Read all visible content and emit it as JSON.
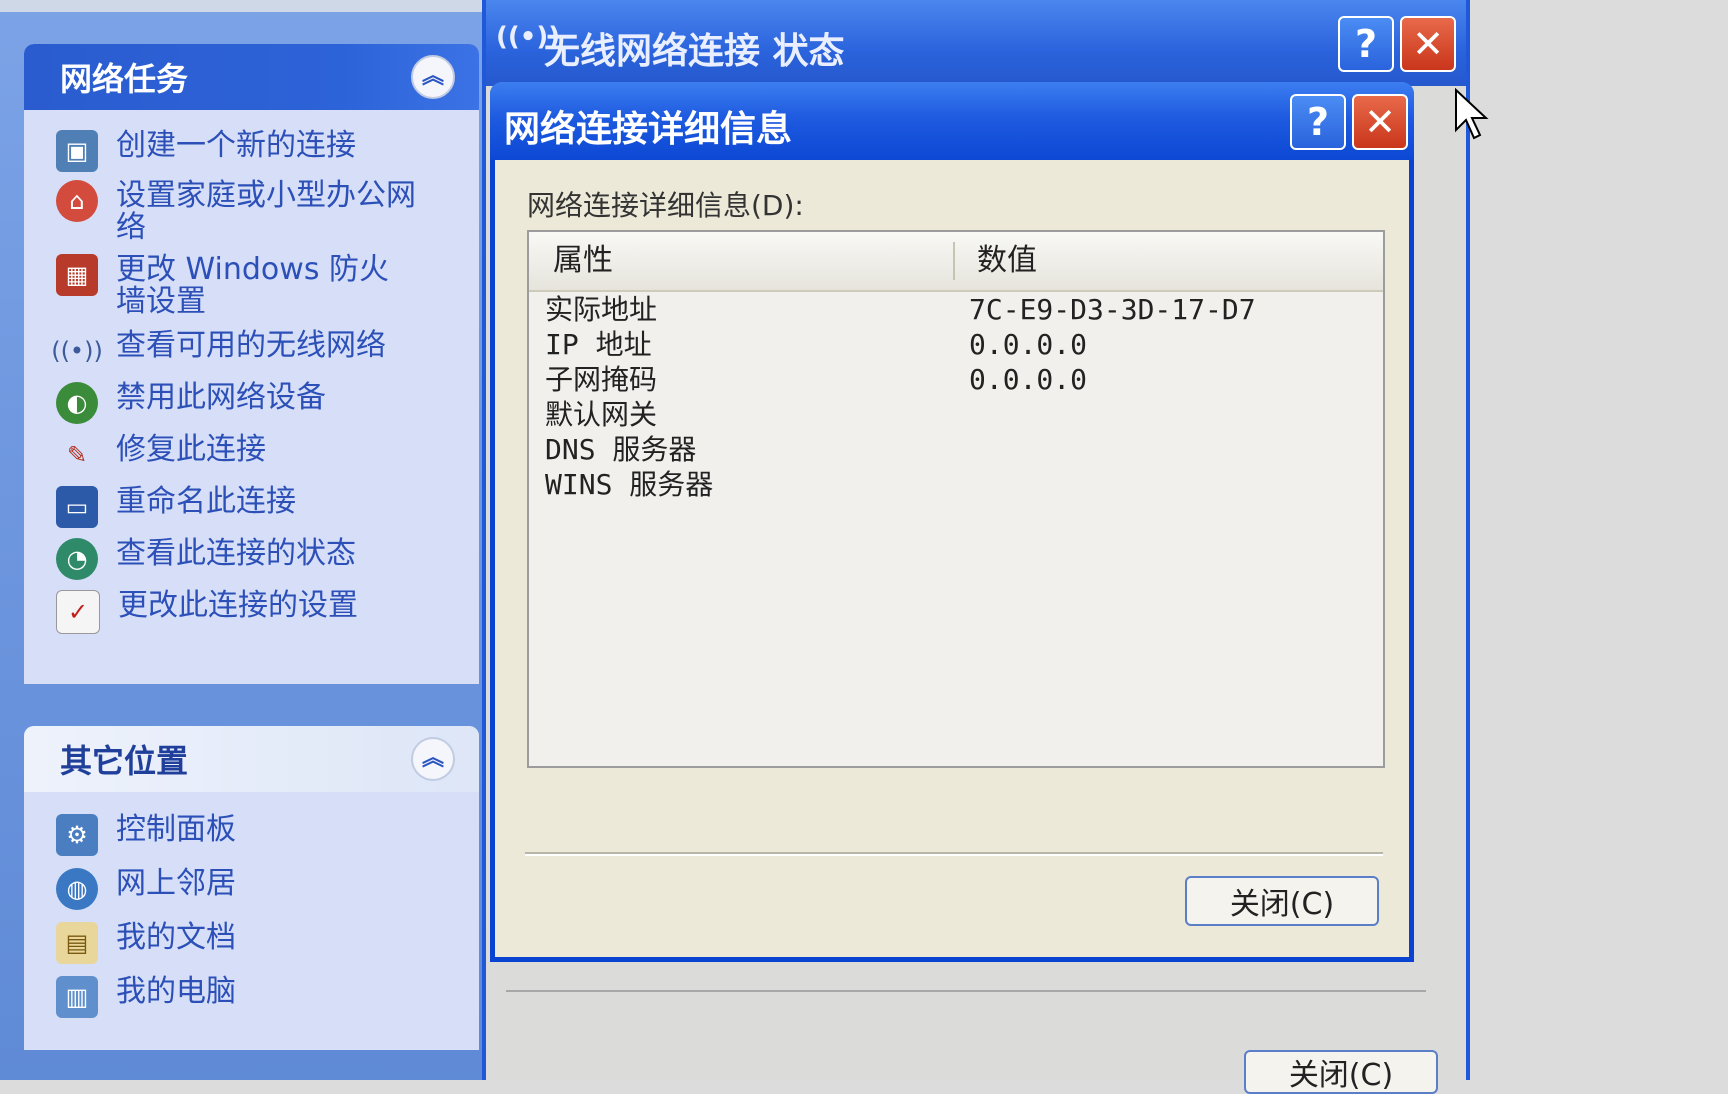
{
  "task_pane": {
    "network_tasks": {
      "title": "网络任务",
      "items": [
        {
          "label": "创建一个新的连接",
          "icon": "new-connection-icon"
        },
        {
          "label": "设置家庭或小型办公网络",
          "icon": "home-network-icon"
        },
        {
          "label": "更改 Windows 防火墙设置",
          "icon": "firewall-icon"
        },
        {
          "label": "查看可用的无线网络",
          "icon": "wireless-icon"
        },
        {
          "label": "禁用此网络设备",
          "icon": "disable-device-icon"
        },
        {
          "label": "修复此连接",
          "icon": "repair-icon"
        },
        {
          "label": "重命名此连接",
          "icon": "rename-icon"
        },
        {
          "label": "查看此连接的状态",
          "icon": "status-icon"
        },
        {
          "label": "更改此连接的设置",
          "icon": "settings-icon"
        }
      ]
    },
    "other_places": {
      "title": "其它位置",
      "items": [
        {
          "label": "控制面板",
          "icon": "control-panel-icon"
        },
        {
          "label": "网上邻居",
          "icon": "network-places-icon"
        },
        {
          "label": "我的文档",
          "icon": "my-documents-icon"
        },
        {
          "label": "我的电脑",
          "icon": "my-computer-icon"
        }
      ]
    }
  },
  "status_window": {
    "title": "无线网络连接 状态",
    "close_button": "关闭(C)"
  },
  "details_dialog": {
    "title": "网络连接详细信息",
    "list_label": "网络连接详细信息(D):",
    "columns": [
      "属性",
      "数值"
    ],
    "rows": [
      {
        "property": "实际地址",
        "value": "7C-E9-D3-3D-17-D7"
      },
      {
        "property": "IP 地址",
        "value": "0.0.0.0"
      },
      {
        "property": "子网掩码",
        "value": "0.0.0.0"
      },
      {
        "property": "默认网关",
        "value": ""
      },
      {
        "property": "DNS 服务器",
        "value": ""
      },
      {
        "property": "WINS 服务器",
        "value": ""
      }
    ],
    "close_button": "关闭(C)"
  },
  "colors": {
    "titlebar_blue": "#0c48d4",
    "task_link": "#2c50b8",
    "dialog_face": "#ece9d8",
    "close_red": "#c9361b"
  }
}
